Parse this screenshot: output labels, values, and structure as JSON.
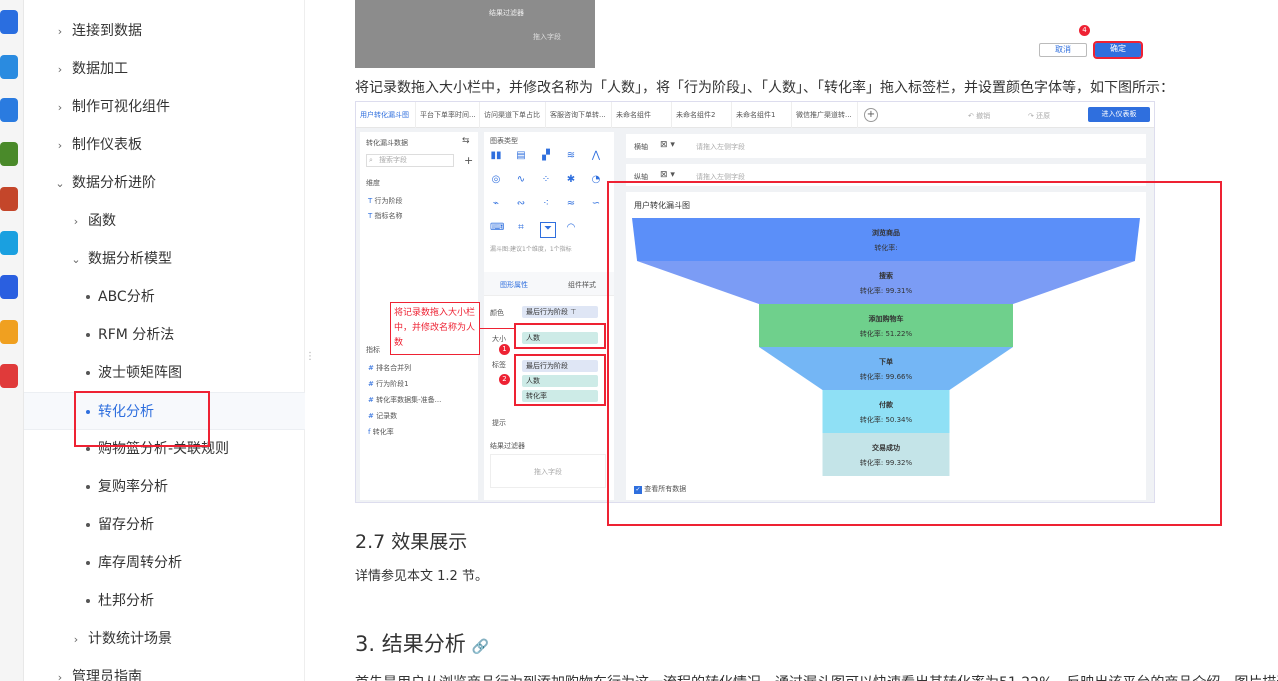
{
  "nav": {
    "items": [
      {
        "label": "连接到数据",
        "level": 0,
        "type": "collapsed"
      },
      {
        "label": "数据加工",
        "level": 0,
        "type": "collapsed"
      },
      {
        "label": "制作可视化组件",
        "level": 0,
        "type": "collapsed"
      },
      {
        "label": "制作仪表板",
        "level": 0,
        "type": "collapsed"
      },
      {
        "label": "数据分析进阶",
        "level": 0,
        "type": "expanded"
      },
      {
        "label": "函数",
        "level": 1,
        "type": "collapsed"
      },
      {
        "label": "数据分析模型",
        "level": 1,
        "type": "expanded"
      },
      {
        "label": "ABC分析",
        "level": 2,
        "type": "leaf"
      },
      {
        "label": "RFM 分析法",
        "level": 2,
        "type": "leaf"
      },
      {
        "label": "波士顿矩阵图",
        "level": 2,
        "type": "leaf"
      },
      {
        "label": "转化分析",
        "level": 2,
        "type": "leaf",
        "active": true
      },
      {
        "label": "购物篮分析-关联规则",
        "level": 2,
        "type": "leaf"
      },
      {
        "label": "复购率分析",
        "level": 2,
        "type": "leaf"
      },
      {
        "label": "留存分析",
        "level": 2,
        "type": "leaf"
      },
      {
        "label": "库存周转分析",
        "level": 2,
        "type": "leaf"
      },
      {
        "label": "杜邦分析",
        "level": 2,
        "type": "leaf"
      },
      {
        "label": "计数统计场景",
        "level": 1,
        "type": "collapsed"
      },
      {
        "label": "管理员指南",
        "level": 0,
        "type": "collapsed"
      }
    ]
  },
  "content": {
    "description": "将记录数拖入大小栏中，并修改名称为「人数」，将「行为阶段」、「人数」、「转化率」拖入标签栏，并设置颜色字体等，如下图所示：",
    "section_27": "2.7 效果展示",
    "section_27_text": "详情参见本文 1.2 节。",
    "section_3": "3. 结果分析",
    "cut_text": "首先是用户从浏览商品行为到添加购物车行为这一流程的转化情况，通过漏斗图可以快速看出其转化率为51.22%，反映出该平台的商品介绍、图片描述"
  },
  "shot1": {
    "result_filter": "结果过滤器",
    "drag_field": "拖入字段",
    "cancel": "取消",
    "confirm": "确定",
    "step4": "4"
  },
  "shot2": {
    "tabs": [
      "用户转化漏斗图",
      "平台下单率时间...",
      "访问渠道下单占比",
      "客服咨询下单转...",
      "未命名组件",
      "未命名组件2",
      "未命名组件1",
      "微信推广渠道转..."
    ],
    "undo": "撤销",
    "redo": "还原",
    "enter_dashboard": "进入仪表板",
    "dataset": "转化漏斗数据",
    "search_placeholder": "搜索字段",
    "dimension": "维度",
    "dim_fields": [
      "行为阶段",
      "指标名称"
    ],
    "measure": "指标",
    "measure_fields": [
      "排名合并列",
      "行为阶段1",
      "转化率数据集-准备...",
      "记录数",
      "转化率"
    ],
    "chart_type": "图表类型",
    "funnel_hint": "漏斗图:建议1个维度，1个指标",
    "graph_attr": "图形属性",
    "component_style": "组件样式",
    "color": "颜色",
    "size": "大小",
    "label": "标签",
    "tooltip": "提示",
    "color_pill": "最后行为阶段",
    "size_pill": "人数",
    "label_pills": [
      "最后行为阶段",
      "人数",
      "转化率"
    ],
    "result_filter": "结果过滤器",
    "drag_field": "拖入字段",
    "x_axis": "横轴",
    "y_axis": "纵轴",
    "x_placeholder": "请拖入左侧字段",
    "y_placeholder": "请拖入左侧字段",
    "callout": "将记录数拖入大小栏中，并修改名称为人数",
    "step1": "1",
    "step2": "2",
    "chart_title": "用户转化漏斗图",
    "view_all": "查看所有数据"
  },
  "chart_data": {
    "type": "funnel",
    "title": "用户转化漏斗图",
    "stages": [
      {
        "name": "浏览商品",
        "rate_label": "转化率:",
        "color": "#5b8ff9"
      },
      {
        "name": "搜索",
        "rate_label": "转化率: 99.31%",
        "color": "#7b9cf5"
      },
      {
        "name": "添加购物车",
        "rate_label": "转化率: 51.22%",
        "color": "#6fd08c"
      },
      {
        "name": "下单",
        "rate_label": "转化率: 99.66%",
        "color": "#74b6f5"
      },
      {
        "name": "付款",
        "rate_label": "转化率: 50.34%",
        "color": "#8fe0f5"
      },
      {
        "name": "交易成功",
        "rate_label": "转化率: 99.32%",
        "color": "#c4e4e8"
      }
    ],
    "relative_widths": [
      1.0,
      0.98,
      0.5,
      0.5,
      0.25,
      0.25
    ]
  },
  "colors": {
    "accent": "#2f6fde",
    "annotation": "#ee2233"
  }
}
